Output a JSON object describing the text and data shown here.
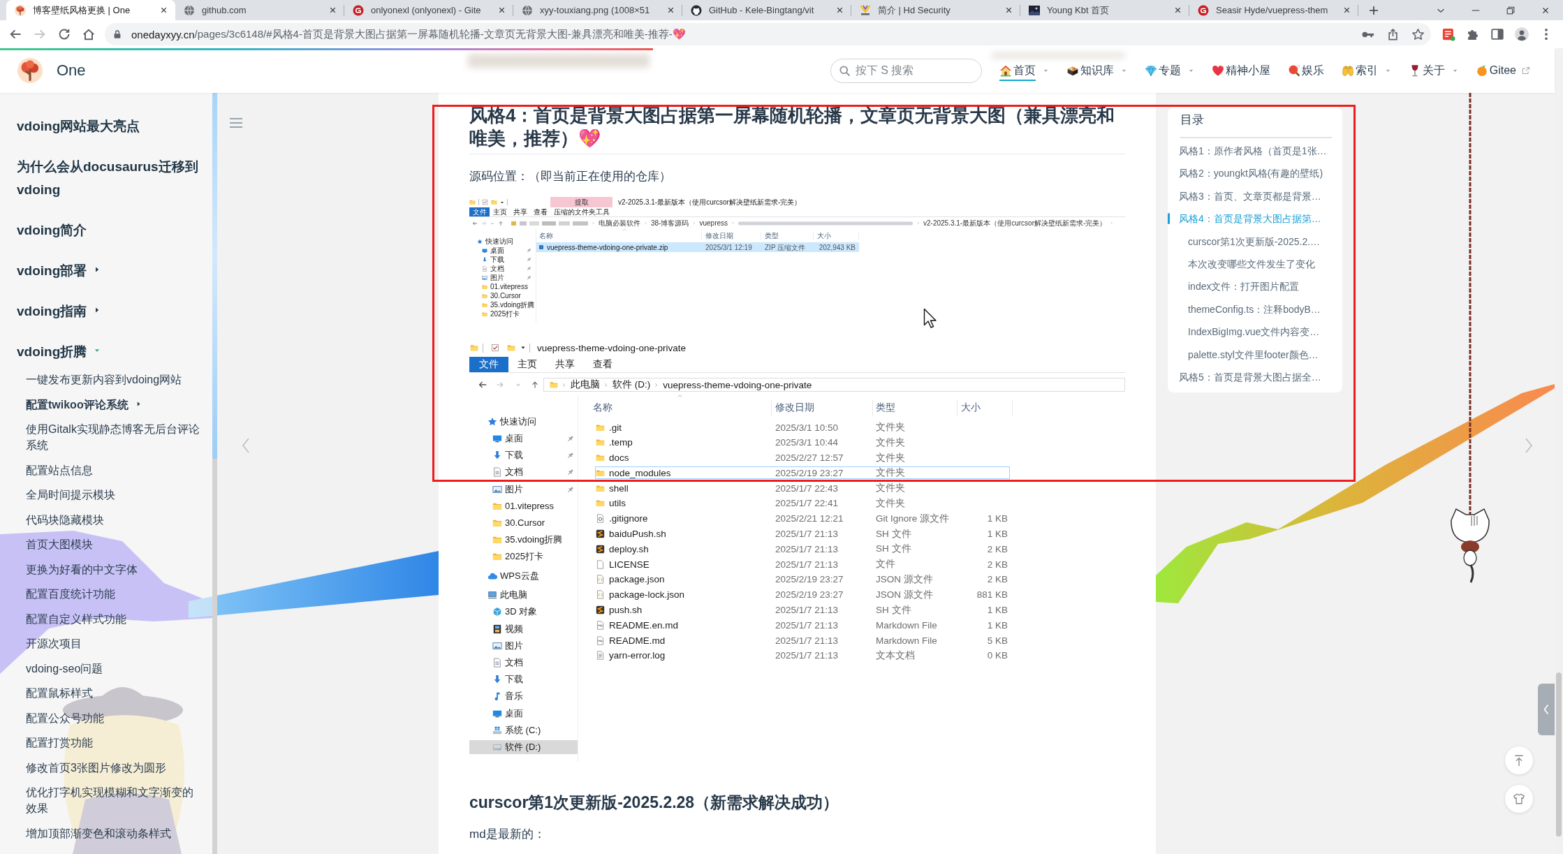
{
  "browser": {
    "tabs": [
      {
        "title": "博客壁纸风格更换 | One",
        "kind": "tree",
        "selected": true
      },
      {
        "title": "github.com",
        "kind": "globe",
        "selected": false
      },
      {
        "title": "onlyonexl (onlyonexl) - Gite",
        "kind": "circle-g",
        "selected": false
      },
      {
        "title": "xyy-touxiang.png (1008×51",
        "kind": "globe",
        "selected": false
      },
      {
        "title": "GitHub - Kele-Bingtang/vit",
        "kind": "octocat",
        "selected": false
      },
      {
        "title": "简介 | Hd Security",
        "kind": "v-mark",
        "selected": false
      },
      {
        "title": "Young Kbt 首页",
        "kind": "thumbnail",
        "selected": false
      },
      {
        "title": "Seasir Hyde/vuepress-them",
        "kind": "circle-g",
        "selected": false
      }
    ],
    "forward_disabled": true,
    "address": {
      "host": "onedayxyy.cn",
      "path": "/pages/3c6148/#风格4-首页是背景大图占据第一屏幕随机轮播-文章页无背景大图-兼具漂亮和唯美-推荐-💖"
    }
  },
  "reading_progress": {
    "level": 0.42
  },
  "navbar": {
    "site_name": "One",
    "search": {
      "placeholder": "按下 S 搜索"
    },
    "links": [
      {
        "label": "首页",
        "kind": "house",
        "selected": true,
        "dropdown": true,
        "external": false
      },
      {
        "label": "知识库",
        "kind": "box",
        "selected": false,
        "dropdown": true,
        "external": false
      },
      {
        "label": "专题",
        "kind": "gem",
        "selected": false,
        "dropdown": true,
        "external": false
      },
      {
        "label": "精神小屋",
        "kind": "heart",
        "selected": false,
        "dropdown": false,
        "external": false
      },
      {
        "label": "娱乐",
        "kind": "paddle",
        "selected": false,
        "dropdown": false,
        "external": false
      },
      {
        "label": "索引",
        "kind": "hands",
        "selected": false,
        "dropdown": true,
        "external": false
      },
      {
        "label": "关于",
        "kind": "glass",
        "selected": false,
        "dropdown": true,
        "external": false
      },
      {
        "label": "Gitee",
        "kind": "fruit",
        "selected": false,
        "dropdown": false,
        "external": true
      }
    ]
  },
  "sidebar": {
    "items": [
      {
        "label": "vdoing网站最大亮点",
        "kind": "page"
      },
      {
        "label": "为什么会从docusaurus迁移到vdoing",
        "kind": "page"
      },
      {
        "label": "vdoing简介",
        "kind": "page"
      },
      {
        "label": "vdoing部署",
        "kind": "group",
        "expanded": false
      },
      {
        "label": "vdoing指南",
        "kind": "group",
        "expanded": false
      },
      {
        "label": "vdoing折腾",
        "kind": "group",
        "expanded": true,
        "children": [
          {
            "label": "一键发布更新内容到vdoing网站",
            "kind": "page"
          },
          {
            "label": "配置twikoo评论系统",
            "kind": "group",
            "expanded": false
          },
          {
            "label": "使用Gitalk实现静态博客无后台评论系统",
            "kind": "page"
          },
          {
            "label": "配置站点信息",
            "kind": "page"
          },
          {
            "label": "全局时间提示模块",
            "kind": "page"
          },
          {
            "label": "代码块隐藏模块",
            "kind": "page"
          },
          {
            "label": "首页大图模块",
            "kind": "page"
          },
          {
            "label": "更换为好看的中文字体",
            "kind": "page"
          },
          {
            "label": "配置百度统计功能",
            "kind": "page"
          },
          {
            "label": "配置自定义样式功能",
            "kind": "page"
          },
          {
            "label": "开源次项目",
            "kind": "page"
          },
          {
            "label": "vdoing-seo问题",
            "kind": "page"
          },
          {
            "label": "配置鼠标样式",
            "kind": "page"
          },
          {
            "label": "配置公众号功能",
            "kind": "page"
          },
          {
            "label": "配置打赏功能",
            "kind": "page"
          },
          {
            "label": "修改首页3张图片修改为圆形",
            "kind": "page"
          },
          {
            "label": "优化打字机实现模糊和文字渐变的效果",
            "kind": "page"
          },
          {
            "label": "增加顶部渐变色和滚动条样式",
            "kind": "page"
          }
        ]
      }
    ]
  },
  "article": {
    "heading": "风格4：首页是背景大图占据第一屏幕随机轮播，文章页无背景大图（兼具漂亮和唯美，推荐）💖",
    "source_note": "源码位置：（即当前正在使用的仓库）",
    "archive_window": {
      "context_tab": "提取",
      "title": "v2-2025.3.1-最新版本（使用curcsor解决壁纸新需求-完美）",
      "ribbon_tabs": [
        {
          "label": "文件",
          "selected": true
        },
        {
          "label": "主页",
          "selected": false
        },
        {
          "label": "共享",
          "selected": false
        },
        {
          "label": "查看",
          "selected": false
        },
        {
          "label": "压缩的文件夹工具",
          "selected": false
        }
      ],
      "path": [
        {
          "kind": "pixelated"
        },
        {
          "kind": "text",
          "label": "电脑必装软件"
        },
        {
          "kind": "text",
          "label": "38-博客源码"
        },
        {
          "kind": "text",
          "label": "vuepress"
        },
        {
          "kind": "blurred"
        },
        {
          "kind": "text",
          "label": "v2-2025.3.1-最新版本（使用curcsor解决壁纸新需求-完美）"
        }
      ],
      "nav": [
        {
          "label": "快速访问",
          "kind": "star",
          "selected": false,
          "children": [
            {
              "label": "桌面",
              "kind": "desktop",
              "pinned": true,
              "selected": false
            },
            {
              "label": "下载",
              "kind": "download",
              "pinned": true,
              "selected": false
            },
            {
              "label": "文档",
              "kind": "document",
              "pinned": true,
              "selected": false
            },
            {
              "label": "图片",
              "kind": "picture",
              "pinned": true,
              "selected": false
            },
            {
              "label": "01.vitepress",
              "kind": "folder",
              "pinned": false,
              "selected": false
            },
            {
              "label": "30.Cursor",
              "kind": "folder",
              "pinned": false,
              "selected": false
            },
            {
              "label": "35.vdoing折腾",
              "kind": "folder",
              "pinned": false,
              "selected": false
            },
            {
              "label": "2025打卡",
              "kind": "folder",
              "pinned": false,
              "selected": false
            }
          ]
        }
      ],
      "columns": [
        "名称",
        "修改日期",
        "类型",
        "大小"
      ],
      "rows": [
        {
          "name": "vuepress-theme-vdoing-one-private.zip",
          "modified": "2025/3/1 12:19",
          "type": "ZIP 压缩文件",
          "size": "202,943 KB",
          "kind": "zip",
          "selected": true
        }
      ]
    },
    "folder_window": {
      "title": "vuepress-theme-vdoing-one-private",
      "ribbon_tabs": [
        {
          "label": "文件",
          "selected": true
        },
        {
          "label": "主页",
          "selected": false
        },
        {
          "label": "共享",
          "selected": false
        },
        {
          "label": "查看",
          "selected": false
        }
      ],
      "path": [
        "此电脑",
        "软件 (D:)",
        "vuepress-theme-vdoing-one-private"
      ],
      "nav": [
        {
          "label": "快速访问",
          "kind": "star",
          "selected": false,
          "children": [
            {
              "label": "桌面",
              "kind": "desktop",
              "pinned": true,
              "selected": false
            },
            {
              "label": "下载",
              "kind": "download",
              "pinned": true,
              "selected": false
            },
            {
              "label": "文档",
              "kind": "document",
              "pinned": true,
              "selected": false
            },
            {
              "label": "图片",
              "kind": "picture",
              "pinned": true,
              "selected": false
            },
            {
              "label": "01.vitepress",
              "kind": "folder",
              "pinned": false,
              "selected": false
            },
            {
              "label": "30.Cursor",
              "kind": "folder",
              "pinned": false,
              "selected": false
            },
            {
              "label": "35.vdoing折腾",
              "kind": "folder",
              "pinned": false,
              "selected": false
            },
            {
              "label": "2025打卡",
              "kind": "folder",
              "pinned": false,
              "selected": false
            }
          ]
        },
        {
          "label": "WPS云盘",
          "kind": "cloud",
          "selected": false
        },
        {
          "label": "此电脑",
          "kind": "computer",
          "selected": false,
          "children": [
            {
              "label": "3D 对象",
              "kind": "cube",
              "pinned": false,
              "selected": false
            },
            {
              "label": "视频",
              "kind": "film",
              "pinned": false,
              "selected": false
            },
            {
              "label": "图片",
              "kind": "picture",
              "pinned": false,
              "selected": false
            },
            {
              "label": "文档",
              "kind": "document",
              "pinned": false,
              "selected": false
            },
            {
              "label": "下载",
              "kind": "download",
              "pinned": false,
              "selected": false
            },
            {
              "label": "音乐",
              "kind": "music",
              "pinned": false,
              "selected": false
            },
            {
              "label": "桌面",
              "kind": "desktop",
              "pinned": false,
              "selected": false
            },
            {
              "label": "系统 (C:)",
              "kind": "system-drive",
              "pinned": false,
              "selected": false
            },
            {
              "label": "软件 (D:)",
              "kind": "drive",
              "pinned": false,
              "selected": true
            }
          ]
        }
      ],
      "columns": [
        "名称",
        "修改日期",
        "类型",
        "大小"
      ],
      "rows": [
        {
          "name": ".git",
          "modified": "2025/3/1 10:50",
          "type": "文件夹",
          "kind": "folder",
          "selected": false,
          "focused": false
        },
        {
          "name": ".temp",
          "modified": "2025/3/1 10:44",
          "type": "文件夹",
          "kind": "folder",
          "selected": false,
          "focused": false
        },
        {
          "name": "docs",
          "modified": "2025/2/27 12:57",
          "type": "文件夹",
          "kind": "folder",
          "selected": false,
          "focused": false
        },
        {
          "name": "node_modules",
          "modified": "2025/2/19 23:27",
          "type": "文件夹",
          "kind": "folder",
          "selected": false,
          "focused": true
        },
        {
          "name": "shell",
          "modified": "2025/1/7 22:43",
          "type": "文件夹",
          "kind": "folder",
          "selected": false,
          "focused": false
        },
        {
          "name": "utils",
          "modified": "2025/1/7 22:41",
          "type": "文件夹",
          "kind": "folder",
          "selected": false,
          "focused": false
        },
        {
          "name": ".gitignore",
          "modified": "2025/2/21 12:21",
          "type": "Git Ignore 源文件",
          "size": "1 KB",
          "kind": "gitignore",
          "selected": false,
          "focused": false
        },
        {
          "name": "baiduPush.sh",
          "modified": "2025/1/7 21:13",
          "type": "SH 文件",
          "size": "1 KB",
          "kind": "script",
          "selected": false,
          "focused": false
        },
        {
          "name": "deploy.sh",
          "modified": "2025/1/7 21:13",
          "type": "SH 文件",
          "size": "2 KB",
          "kind": "script",
          "selected": false,
          "focused": false
        },
        {
          "name": "LICENSE",
          "modified": "2025/1/7 21:13",
          "type": "文件",
          "size": "2 KB",
          "kind": "blank",
          "selected": false,
          "focused": false
        },
        {
          "name": "package.json",
          "modified": "2025/2/19 23:27",
          "type": "JSON 源文件",
          "size": "2 KB",
          "kind": "json",
          "selected": false,
          "focused": false
        },
        {
          "name": "package-lock.json",
          "modified": "2025/2/19 23:27",
          "type": "JSON 源文件",
          "size": "881 KB",
          "kind": "json",
          "selected": false,
          "focused": false
        },
        {
          "name": "push.sh",
          "modified": "2025/1/7 21:13",
          "type": "SH 文件",
          "size": "1 KB",
          "kind": "script",
          "selected": false,
          "focused": false
        },
        {
          "name": "README.en.md",
          "modified": "2025/1/7 21:13",
          "type": "Markdown File",
          "size": "1 KB",
          "kind": "markdown",
          "selected": false,
          "focused": false
        },
        {
          "name": "README.md",
          "modified": "2025/1/7 21:13",
          "type": "Markdown File",
          "size": "5 KB",
          "kind": "markdown",
          "selected": false,
          "focused": false
        },
        {
          "name": "yarn-error.log",
          "modified": "2025/1/7 21:13",
          "type": "文本文档",
          "size": "0 KB",
          "kind": "text",
          "selected": false,
          "focused": false
        }
      ]
    },
    "subheading": "curscor第1次更新版-2025.2.28（新需求解决成功）",
    "paragraph": "md是最新的："
  },
  "toc": {
    "title": "目录",
    "items": [
      {
        "label": "风格1：原作者风格（首页是1张…",
        "selected": false
      },
      {
        "label": "风格2：youngkt风格(有趣的壁纸)",
        "selected": false
      },
      {
        "label": "风格3：首页、文章页都是背景…",
        "selected": false
      },
      {
        "label": "风格4：首页是背景大图占据第…",
        "selected": true,
        "children": [
          {
            "label": "curscor第1次更新版-2025.2.…",
            "selected": false
          },
          {
            "label": "本次改变哪些文件发生了变化",
            "selected": false
          },
          {
            "label": "index文件：打开图片配置",
            "selected": false
          },
          {
            "label": "themeConfig.ts：注释bodyB…",
            "selected": false
          },
          {
            "label": "IndexBigImg.vue文件内容变…",
            "selected": false
          },
          {
            "label": "palette.styl文件里footer颜色…",
            "selected": false
          }
        ]
      },
      {
        "label": "风格5：首页是背景大图占据全…",
        "selected": false
      }
    ]
  }
}
